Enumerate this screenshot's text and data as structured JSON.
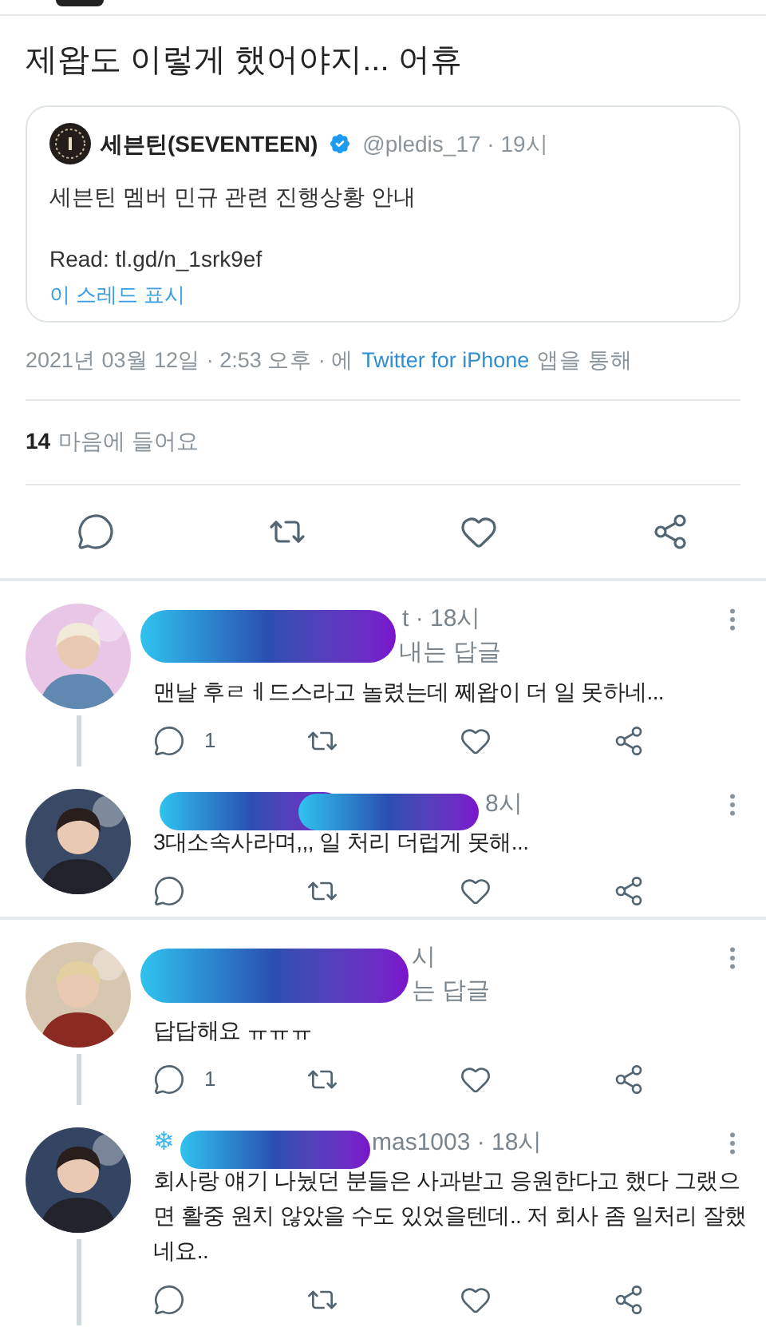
{
  "tweet": {
    "text": "제왑도 이렇게 했어야지... 어휴",
    "quote": {
      "name": "세븐틴(SEVENTEEN)",
      "handle": "@pledis_17 · 19시",
      "text": "세븐틴 멤버 민규 관련 진행상황 안내",
      "link": "Read: tl.gd/n_1srk9ef",
      "show_thread": "이 스레드 표시"
    },
    "timestamp": "2021년 03월 12일 · 2:53 오후 · 에",
    "source": "Twitter for iPhone",
    "source_suffix": "앱을 통해",
    "likes_count": "14",
    "likes_label": "마음에 들어요"
  },
  "replies": [
    {
      "meta": "t · 18시",
      "reply_to": "내는 답글",
      "text": "맨날 후ㄹㅔ드스라고 놀렸는데 쩨왑이 더 일 못하네...",
      "reply_count": "1",
      "thread_below": true
    },
    {
      "meta": "8시",
      "text": "3대소속사라며,,, 일 처리 더럽게 못해...",
      "thread_below": false
    },
    {
      "meta": "시",
      "reply_to": "는 답글",
      "text": "답답해요 ㅠㅠㅠ",
      "reply_count": "1",
      "thread_below": true
    },
    {
      "prefix": "❄",
      "meta": "mas1003 · 18시",
      "text": "회사랑 얘기 나눴던 분들은 사과받고 응원한다고 했다 그랬으면 활중 원치 않았을 수도 있었을텐데.. 저 회사 좀 일처리 잘했네요..",
      "thread_below": true
    }
  ]
}
